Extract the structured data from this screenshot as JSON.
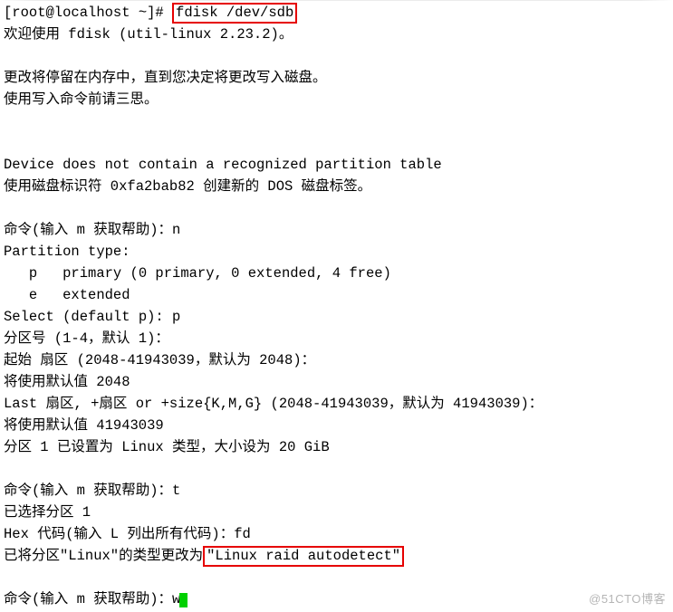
{
  "prompt": "[root@localhost ~]# ",
  "cmd": "fdisk /dev/sdb",
  "welcome": "欢迎使用 fdisk (util-linux 2.23.2)。",
  "changes_note1": "更改将停留在内存中，直到您决定将更改写入磁盘。",
  "changes_note2": "使用写入命令前请三思。",
  "device_msg": "Device does not contain a recognized partition table",
  "disk_ident": "使用磁盘标识符 0xfa2bab82 创建新的 DOS 磁盘标签。",
  "cmd_label": "命令(输入 m 获取帮助)：",
  "input_n": "n",
  "ptype_header": "Partition type:",
  "ptype_p": "   p   primary (0 primary, 0 extended, 4 free)",
  "ptype_e": "   e   extended",
  "select_default": "Select (default p): ",
  "input_p": "p",
  "partnum": "分区号 (1-4，默认 1)：",
  "start_sector": "起始 扇区 (2048-41943039，默认为 2048)：",
  "use_default1": "将使用默认值 2048",
  "last_sector": "Last 扇区, +扇区 or +size{K,M,G} (2048-41943039，默认为 41943039)：",
  "use_default2": "将使用默认值 41943039",
  "part_set": "分区 1 已设置为 Linux 类型，大小设为 20 GiB",
  "input_t": "t",
  "selected_part": "已选择分区 1",
  "hex_prompt": "Hex 代码(输入 L 列出所有代码)：",
  "input_fd": "fd",
  "changed_prefix": "已将分区\"Linux\"的类型更改为",
  "changed_type": "\"Linux raid autodetect\"",
  "input_w": "w",
  "watermark": "@51CTO博客"
}
